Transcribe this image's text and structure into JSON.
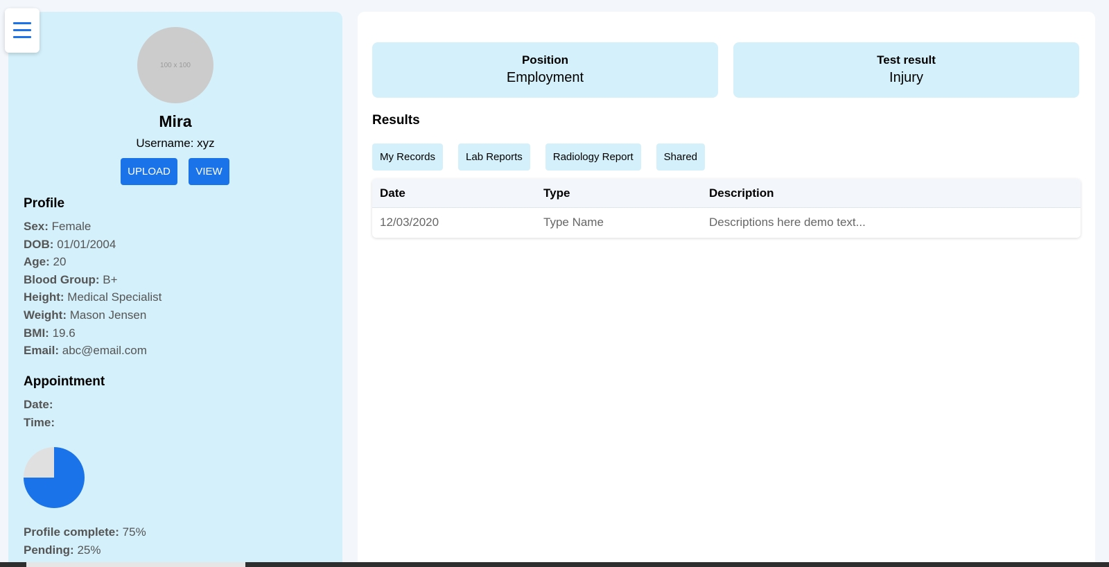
{
  "menu": {
    "icon": "hamburger-menu-icon"
  },
  "sidebar": {
    "avatar_placeholder": "100 x 100",
    "name": "Mira",
    "username": "Username: xyz",
    "buttons": {
      "upload": "UPLOAD",
      "view": "VIEW"
    },
    "profile": {
      "title": "Profile",
      "fields": [
        {
          "label": "Sex:",
          "value": "Female"
        },
        {
          "label": "DOB:",
          "value": "01/01/2004"
        },
        {
          "label": "Age:",
          "value": "20"
        },
        {
          "label": "Blood Group:",
          "value": "B+"
        },
        {
          "label": "Height:",
          "value": "Medical Specialist"
        },
        {
          "label": "Weight:",
          "value": "Mason Jensen"
        },
        {
          "label": "BMI:",
          "value": "19.6"
        },
        {
          "label": "Email:",
          "value": "abc@email.com"
        }
      ]
    },
    "appointment": {
      "title": "Appointment",
      "fields": [
        {
          "label": "Date:",
          "value": ""
        },
        {
          "label": "Time:",
          "value": ""
        }
      ]
    },
    "progress": {
      "complete_fraction": 0.75,
      "colors": {
        "complete": "#1a73e8",
        "pending": "#e0e0e0"
      },
      "fields": [
        {
          "label": "Profile complete:",
          "value": "75%"
        },
        {
          "label": "Pending:",
          "value": "25%"
        }
      ]
    }
  },
  "main": {
    "cards": [
      {
        "label": "Position",
        "value": "Employment"
      },
      {
        "label": "Test result",
        "value": "Injury"
      }
    ],
    "results_title": "Results",
    "tabs": [
      "My Records",
      "Lab Reports",
      "Radiology Report",
      "Shared"
    ],
    "table": {
      "headers": [
        "Date",
        "Type",
        "Description"
      ],
      "rows": [
        [
          "12/03/2020",
          "Type Name",
          "Descriptions here demo text..."
        ]
      ]
    }
  },
  "colors": {
    "accent": "#1a73e8",
    "panel_light_blue": "#d4f0fa"
  }
}
